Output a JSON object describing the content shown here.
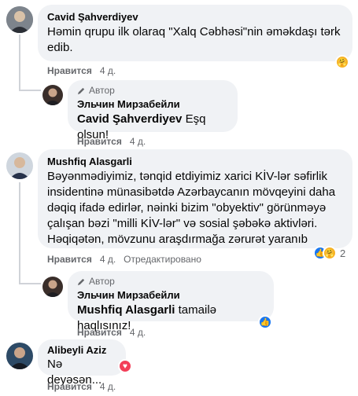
{
  "comments": [
    {
      "author": "Cavid Şahverdiyev",
      "text": "Həmin qrupu ilk olaraq \"Xalq Cəbhəsi\"nin əməkdaşı tərk edib.",
      "actions": {
        "like": "Нравится",
        "time": "4 д."
      }
    },
    {
      "badge": "Автор",
      "author": "Эльчин Мирзабейли",
      "mention": "Cavid Şahverdiyev",
      "text": " Eşq olsun!",
      "actions": {
        "like": "Нравится",
        "time": "4 д."
      }
    },
    {
      "author": "Mushfiq Alasgarli",
      "text": "Bəyənmədiyimiz, tənqid etdiyimiz xarici KİV-lər səfirlik insidentinə münasibətdə Azərbaycanın mövqeyini daha dəqiq ifadə edirlər, nəinki bizim \"obyektiv\" görünməyə çalışan bəzi \"milli KİV-lər\" və sosial şəbəkə aktivləri. Həqiqətən, mövzunu araşdırmağa zərurət yaranıb",
      "actions": {
        "like": "Нравится",
        "time": "4 д.",
        "edited": "Отредактировано"
      },
      "reaction_count": "2"
    },
    {
      "badge": "Автор",
      "author": "Эльчин Мирзабейли",
      "mention": "Mushfiq Alasgarli",
      "text": " tamailə haqlısınız!",
      "actions": {
        "like": "Нравится",
        "time": "4 д."
      }
    },
    {
      "author": "Alibeyli Aziz",
      "text": "Nə deyəsən...",
      "actions": {
        "like": "Нравится",
        "time": "4 д."
      }
    }
  ],
  "colors": {
    "bubble": "#f0f2f5",
    "like_blue": "#1877f2",
    "love_red": "#f33e58",
    "haha_yellow": "#f7b125",
    "meta": "#65676b"
  }
}
